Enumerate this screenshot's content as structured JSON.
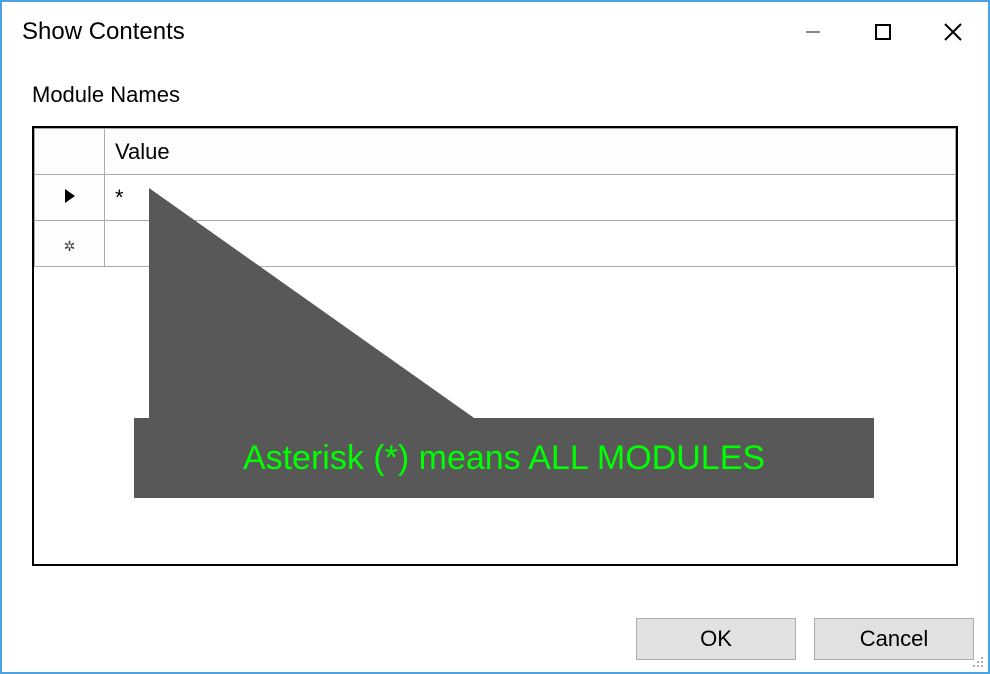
{
  "window": {
    "title": "Show Contents"
  },
  "section": {
    "label": "Module Names"
  },
  "grid": {
    "column_header": "Value",
    "rows": [
      {
        "indicator": "current",
        "value": "*"
      },
      {
        "indicator": "new",
        "value": ""
      }
    ]
  },
  "annotation": {
    "text": "Asterisk (*) means ALL MODULES"
  },
  "buttons": {
    "ok": "OK",
    "cancel": "Cancel"
  }
}
